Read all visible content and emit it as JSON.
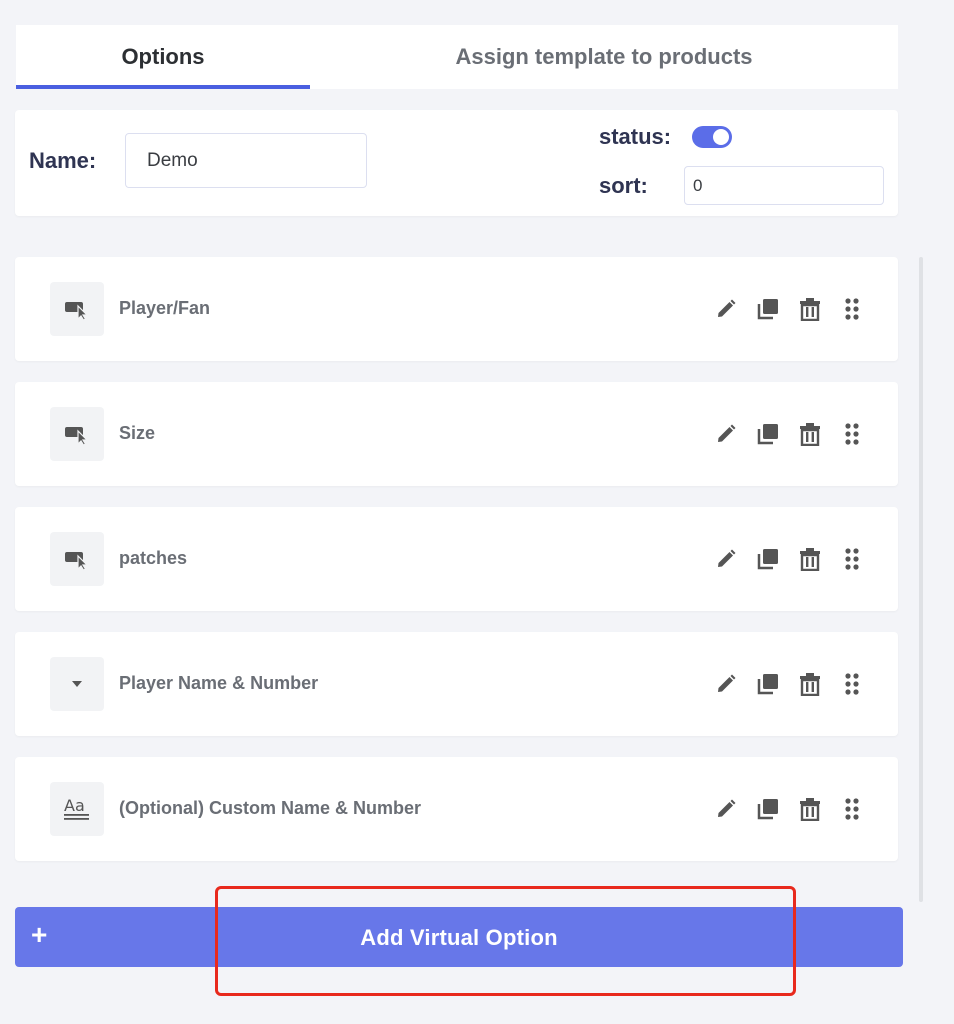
{
  "tabs": [
    {
      "label": "Options",
      "active": true
    },
    {
      "label": "Assign template to products",
      "active": false
    }
  ],
  "settings": {
    "name_label": "Name:",
    "name_value": "Demo",
    "status_label": "status:",
    "status_on": true,
    "sort_label": "sort:",
    "sort_value": "0"
  },
  "options": [
    {
      "label": "Player/Fan",
      "icon": "button-select-icon"
    },
    {
      "label": "Size",
      "icon": "button-select-icon"
    },
    {
      "label": "patches",
      "icon": "button-select-icon"
    },
    {
      "label": "Player Name & Number",
      "icon": "dropdown-caret-icon"
    },
    {
      "label": "(Optional) Custom Name & Number",
      "icon": "text-input-icon"
    }
  ],
  "row_actions": [
    "edit-icon",
    "duplicate-icon",
    "delete-icon",
    "drag-handle-icon"
  ],
  "add_button": {
    "plus": "+",
    "label": "Add Virtual Option"
  },
  "colors": {
    "accent": "#6777e9",
    "tab_underline": "#4a5fe0",
    "toggle_on": "#5b6de8",
    "highlight": "#e8291d",
    "icon_gray": "#555555"
  }
}
